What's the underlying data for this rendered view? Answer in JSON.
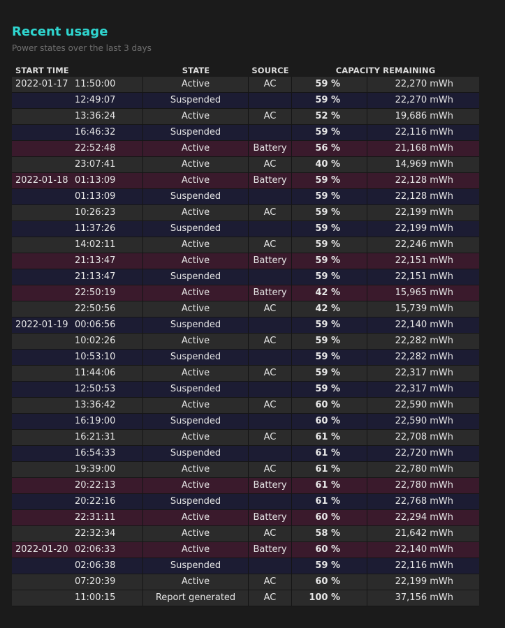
{
  "header": {
    "title": "Recent usage",
    "subtitle": "Power states over the last 3 days"
  },
  "table": {
    "columns": {
      "start_time": "START TIME",
      "state": "STATE",
      "source": "SOURCE",
      "capacity": "CAPACITY REMAINING"
    },
    "rows": [
      {
        "date": "2022-01-17",
        "time": "11:50:00",
        "state": "Active",
        "source": "AC",
        "percent": "59 %",
        "capacity": "22,270 mWh"
      },
      {
        "date": "",
        "time": "12:49:07",
        "state": "Suspended",
        "source": "",
        "percent": "59 %",
        "capacity": "22,270 mWh"
      },
      {
        "date": "",
        "time": "13:36:24",
        "state": "Active",
        "source": "AC",
        "percent": "52 %",
        "capacity": "19,686 mWh"
      },
      {
        "date": "",
        "time": "16:46:32",
        "state": "Suspended",
        "source": "",
        "percent": "59 %",
        "capacity": "22,116 mWh"
      },
      {
        "date": "",
        "time": "22:52:48",
        "state": "Active",
        "source": "Battery",
        "percent": "56 %",
        "capacity": "21,168 mWh"
      },
      {
        "date": "",
        "time": "23:07:41",
        "state": "Active",
        "source": "AC",
        "percent": "40 %",
        "capacity": "14,969 mWh"
      },
      {
        "date": "2022-01-18",
        "time": "01:13:09",
        "state": "Active",
        "source": "Battery",
        "percent": "59 %",
        "capacity": "22,128 mWh"
      },
      {
        "date": "",
        "time": "01:13:09",
        "state": "Suspended",
        "source": "",
        "percent": "59 %",
        "capacity": "22,128 mWh"
      },
      {
        "date": "",
        "time": "10:26:23",
        "state": "Active",
        "source": "AC",
        "percent": "59 %",
        "capacity": "22,199 mWh"
      },
      {
        "date": "",
        "time": "11:37:26",
        "state": "Suspended",
        "source": "",
        "percent": "59 %",
        "capacity": "22,199 mWh"
      },
      {
        "date": "",
        "time": "14:02:11",
        "state": "Active",
        "source": "AC",
        "percent": "59 %",
        "capacity": "22,246 mWh"
      },
      {
        "date": "",
        "time": "21:13:47",
        "state": "Active",
        "source": "Battery",
        "percent": "59 %",
        "capacity": "22,151 mWh"
      },
      {
        "date": "",
        "time": "21:13:47",
        "state": "Suspended",
        "source": "",
        "percent": "59 %",
        "capacity": "22,151 mWh"
      },
      {
        "date": "",
        "time": "22:50:19",
        "state": "Active",
        "source": "Battery",
        "percent": "42 %",
        "capacity": "15,965 mWh"
      },
      {
        "date": "",
        "time": "22:50:56",
        "state": "Active",
        "source": "AC",
        "percent": "42 %",
        "capacity": "15,739 mWh"
      },
      {
        "date": "2022-01-19",
        "time": "00:06:56",
        "state": "Suspended",
        "source": "",
        "percent": "59 %",
        "capacity": "22,140 mWh"
      },
      {
        "date": "",
        "time": "10:02:26",
        "state": "Active",
        "source": "AC",
        "percent": "59 %",
        "capacity": "22,282 mWh"
      },
      {
        "date": "",
        "time": "10:53:10",
        "state": "Suspended",
        "source": "",
        "percent": "59 %",
        "capacity": "22,282 mWh"
      },
      {
        "date": "",
        "time": "11:44:06",
        "state": "Active",
        "source": "AC",
        "percent": "59 %",
        "capacity": "22,317 mWh"
      },
      {
        "date": "",
        "time": "12:50:53",
        "state": "Suspended",
        "source": "",
        "percent": "59 %",
        "capacity": "22,317 mWh"
      },
      {
        "date": "",
        "time": "13:36:42",
        "state": "Active",
        "source": "AC",
        "percent": "60 %",
        "capacity": "22,590 mWh"
      },
      {
        "date": "",
        "time": "16:19:00",
        "state": "Suspended",
        "source": "",
        "percent": "60 %",
        "capacity": "22,590 mWh"
      },
      {
        "date": "",
        "time": "16:21:31",
        "state": "Active",
        "source": "AC",
        "percent": "61 %",
        "capacity": "22,708 mWh"
      },
      {
        "date": "",
        "time": "16:54:33",
        "state": "Suspended",
        "source": "",
        "percent": "61 %",
        "capacity": "22,720 mWh"
      },
      {
        "date": "",
        "time": "19:39:00",
        "state": "Active",
        "source": "AC",
        "percent": "61 %",
        "capacity": "22,780 mWh"
      },
      {
        "date": "",
        "time": "20:22:13",
        "state": "Active",
        "source": "Battery",
        "percent": "61 %",
        "capacity": "22,780 mWh"
      },
      {
        "date": "",
        "time": "20:22:16",
        "state": "Suspended",
        "source": "",
        "percent": "61 %",
        "capacity": "22,768 mWh"
      },
      {
        "date": "",
        "time": "22:31:11",
        "state": "Active",
        "source": "Battery",
        "percent": "60 %",
        "capacity": "22,294 mWh"
      },
      {
        "date": "",
        "time": "22:32:34",
        "state": "Active",
        "source": "AC",
        "percent": "58 %",
        "capacity": "21,642 mWh"
      },
      {
        "date": "2022-01-20",
        "time": "02:06:33",
        "state": "Active",
        "source": "Battery",
        "percent": "60 %",
        "capacity": "22,140 mWh"
      },
      {
        "date": "",
        "time": "02:06:38",
        "state": "Suspended",
        "source": "",
        "percent": "59 %",
        "capacity": "22,116 mWh"
      },
      {
        "date": "",
        "time": "07:20:39",
        "state": "Active",
        "source": "AC",
        "percent": "60 %",
        "capacity": "22,199 mWh"
      },
      {
        "date": "",
        "time": "11:00:15",
        "state": "Report generated",
        "source": "AC",
        "percent": "100 %",
        "capacity": "37,156 mWh"
      }
    ]
  },
  "colors": {
    "title": "#2fd5cf",
    "row_ac": "#2b2b2b",
    "row_suspended": "#1c1c33",
    "row_battery": "#3a1a2c",
    "background": "#1b1b1b"
  }
}
